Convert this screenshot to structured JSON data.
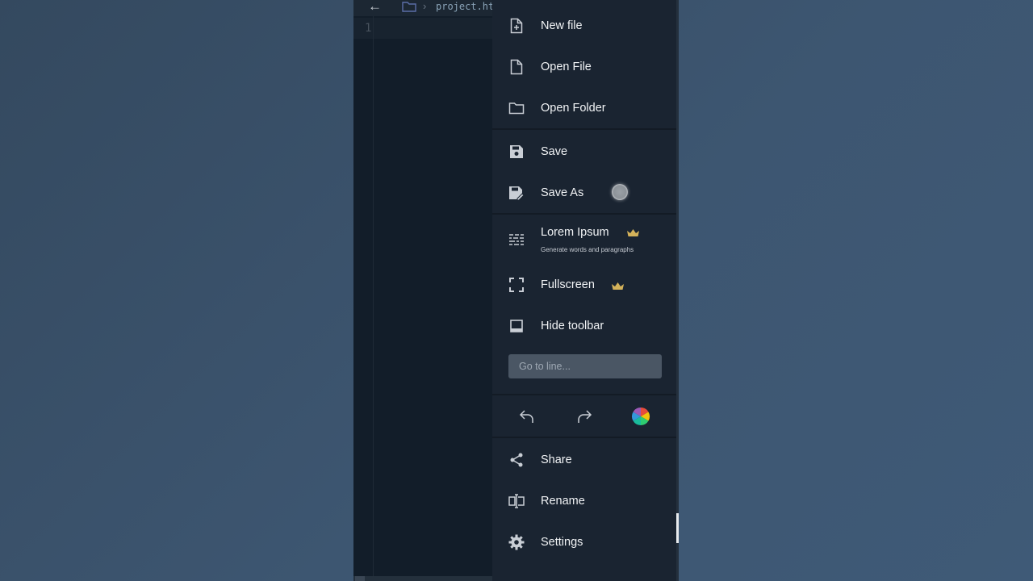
{
  "editor": {
    "filename": "project.htm",
    "line_number": "1"
  },
  "menu": {
    "items_top": [
      {
        "label": "New file",
        "icon": "new-file-icon"
      },
      {
        "label": "Open File",
        "icon": "file-icon"
      },
      {
        "label": "Open Folder",
        "icon": "folder-icon"
      }
    ],
    "items_save": [
      {
        "label": "Save",
        "icon": "save-icon"
      },
      {
        "label": "Save As",
        "icon": "save-as-icon"
      }
    ],
    "lorem": {
      "label": "Lorem Ipsum",
      "subtitle": "Generate words and paragraphs",
      "icon": "lorem-icon",
      "premium": true
    },
    "fullscreen": {
      "label": "Fullscreen",
      "icon": "fullscreen-icon",
      "premium": true
    },
    "hide_toolbar": {
      "label": "Hide toolbar",
      "icon": "toolbar-icon"
    },
    "goto_placeholder": "Go to line...",
    "actions": [
      {
        "name": "undo",
        "icon": "undo-icon"
      },
      {
        "name": "redo",
        "icon": "redo-icon"
      },
      {
        "name": "color-picker",
        "icon": "color-wheel-icon"
      }
    ],
    "items_bottom": [
      {
        "label": "Share",
        "icon": "share-icon"
      },
      {
        "label": "Rename",
        "icon": "rename-icon"
      },
      {
        "label": "Settings",
        "icon": "gear-icon"
      }
    ]
  },
  "colors": {
    "menu_bg": "#1a2431",
    "editor_bg": "#121d29",
    "crown": "#d4b25a",
    "page_bg": "#3d5671"
  }
}
